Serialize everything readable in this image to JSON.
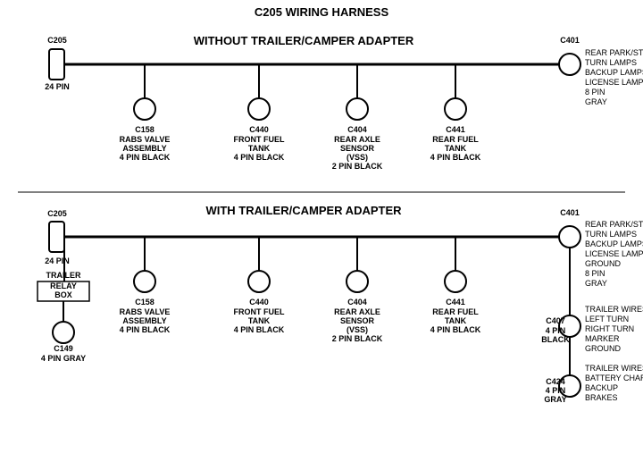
{
  "title": "C205 WIRING HARNESS",
  "section1": {
    "label": "WITHOUT  TRAILER/CAMPER  ADAPTER",
    "left_connector": {
      "id": "C205",
      "pin": "24 PIN"
    },
    "right_connector": {
      "id": "C401",
      "pin": "8 PIN",
      "color": "GRAY",
      "description": [
        "REAR PARK/STOP",
        "TURN LAMPS",
        "BACKUP LAMPS",
        "LICENSE LAMPS"
      ]
    },
    "connectors": [
      {
        "id": "C158",
        "lines": [
          "RABS VALVE",
          "ASSEMBLY",
          "4 PIN BLACK"
        ]
      },
      {
        "id": "C440",
        "lines": [
          "FRONT FUEL",
          "TANK",
          "4 PIN BLACK"
        ]
      },
      {
        "id": "C404",
        "lines": [
          "REAR AXLE",
          "SENSOR",
          "(VSS)",
          "2 PIN BLACK"
        ]
      },
      {
        "id": "C441",
        "lines": [
          "REAR FUEL",
          "TANK",
          "4 PIN BLACK"
        ]
      }
    ]
  },
  "section2": {
    "label": "WITH  TRAILER/CAMPER  ADAPTER",
    "left_connector": {
      "id": "C205",
      "pin": "24 PIN"
    },
    "trailer_relay": {
      "label": "TRAILER",
      "label2": "RELAY",
      "label3": "BOX"
    },
    "bottom_left_connector": {
      "id": "C149",
      "pin": "4 PIN GRAY"
    },
    "right_connector": {
      "id": "C401",
      "pin": "8 PIN",
      "color": "GRAY",
      "description": [
        "REAR PARK/STOP",
        "TURN LAMPS",
        "BACKUP LAMPS",
        "LICENSE LAMPS",
        "GROUND"
      ]
    },
    "right_connector2": {
      "id": "C407",
      "pin": "4 PIN",
      "color": "BLACK",
      "description": [
        "TRAILER WIRES",
        "LEFT TURN",
        "RIGHT TURN",
        "MARKER",
        "GROUND"
      ]
    },
    "right_connector3": {
      "id": "C424",
      "pin": "4 PIN",
      "color": "GRAY",
      "description": [
        "TRAILER WIRES",
        "BATTERY CHARGE",
        "BACKUP",
        "BRAKES"
      ]
    },
    "connectors": [
      {
        "id": "C158",
        "lines": [
          "RABS VALVE",
          "ASSEMBLY",
          "4 PIN BLACK"
        ]
      },
      {
        "id": "C440",
        "lines": [
          "FRONT FUEL",
          "TANK",
          "4 PIN BLACK"
        ]
      },
      {
        "id": "C404",
        "lines": [
          "REAR AXLE",
          "SENSOR",
          "(VSS)",
          "2 PIN BLACK"
        ]
      },
      {
        "id": "C441",
        "lines": [
          "REAR FUEL",
          "TANK",
          "4 PIN BLACK"
        ]
      }
    ]
  }
}
